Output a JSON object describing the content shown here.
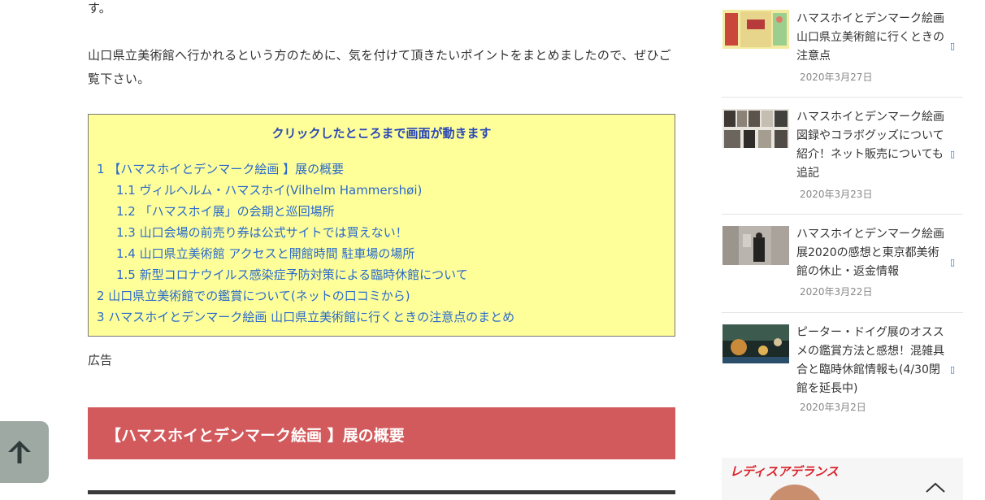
{
  "article": {
    "para1": "す。",
    "para2": "山口県立美術館へ行かれるという方のために、気を付けて頂きたいポイントをまとめましたので、ぜひご覧下さい。",
    "toc": {
      "title": "クリックしたところまで画面が動きます",
      "items": [
        {
          "text": "1 【ハマスホイとデンマーク絵画 】展の概要",
          "sub": false
        },
        {
          "text": "1.1 ヴィルヘルム・ハマスホイ(Vilhelm Hammershøi)",
          "sub": true
        },
        {
          "text": "1.2 「ハマスホイ展」の会期と巡回場所",
          "sub": true
        },
        {
          "text": "1.3 山口会場の前売り券は公式サイトでは買えない！",
          "sub": true
        },
        {
          "text": "1.4 山口県立美術館 アクセスと開館時間 駐車場の場所",
          "sub": true
        },
        {
          "text": "1.5 新型コロナウイルス感染症予防対策による臨時休館について",
          "sub": true
        },
        {
          "text": "2 山口県立美術館での鑑賞について(ネットの口コミから)",
          "sub": false
        },
        {
          "text": "3 ハマスホイとデンマーク絵画 山口県立美術館に行くときの注意点のまとめ",
          "sub": false
        }
      ]
    },
    "ad_label": "広告",
    "section_heading": "【ハマスホイとデンマーク絵画 】展の概要"
  },
  "back_to_top_icon": "arrow-up-icon",
  "sidebar": {
    "items": [
      {
        "title": "ハマスホイとデンマーク絵画 山口県立美術館に行くときの注意点",
        "date": "2020年3月27日"
      },
      {
        "title": "ハマスホイとデンマーク絵画 図録やコラボグッズについて紹介！ネット販売についても追記",
        "date": "2020年3月23日"
      },
      {
        "title": "ハマスホイとデンマーク絵画展2020の感想と東京都美術館の休止・返金情報",
        "date": "2020年3月22日"
      },
      {
        "title": "ピーター・ドイグ展のオススメの鑑賞方法と感想！混雑具合と臨時休館情報も(4/30閉館を延長中)",
        "date": "2020年3月2日"
      }
    ],
    "ad_logo": "レディスアデランス"
  },
  "colors": {
    "toc_bg": "#ffff99",
    "toc_link": "#2a6acb",
    "heading_band": "#d35a5c",
    "back_to_top": "#9fa9a4"
  }
}
